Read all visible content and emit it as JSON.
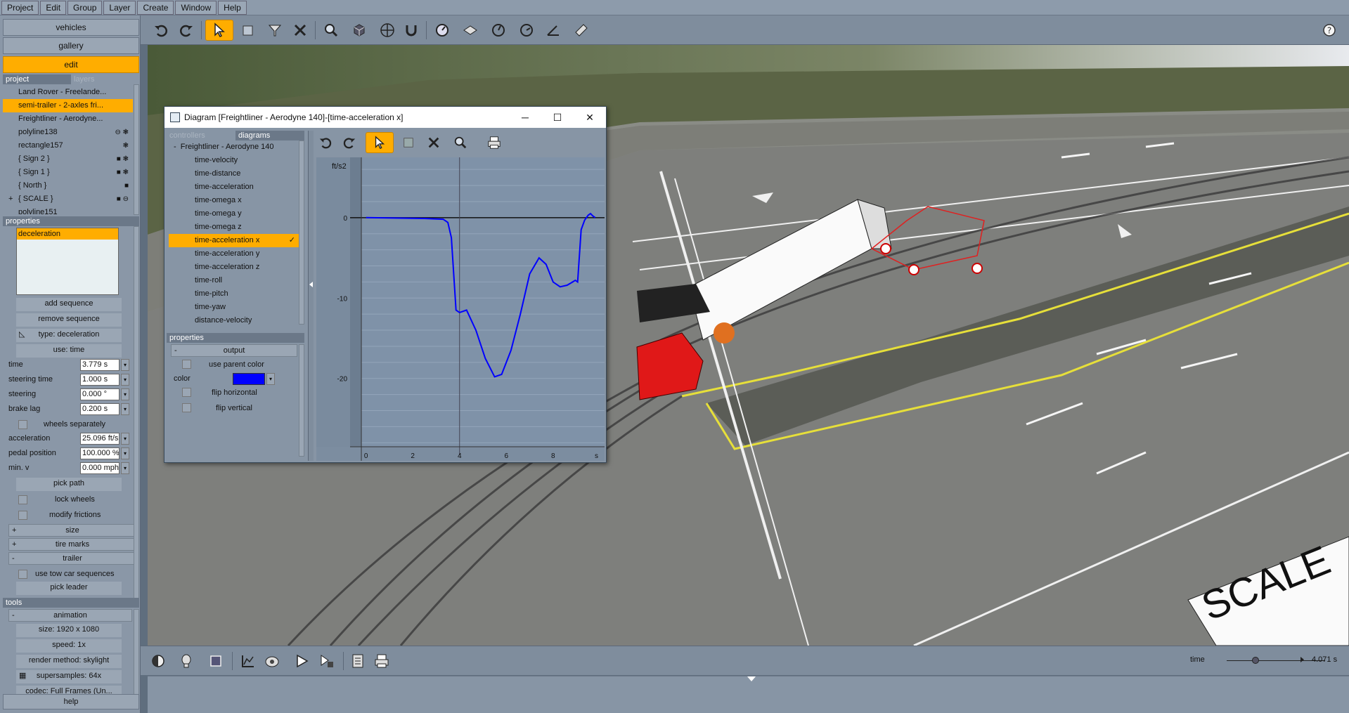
{
  "menu": [
    "Project",
    "Edit",
    "Group",
    "Layer",
    "Create",
    "Window",
    "Help"
  ],
  "left": {
    "top_buttons": [
      "vehicles",
      "gallery",
      "edit"
    ],
    "active_button": "edit",
    "tabs": [
      "project",
      "layers"
    ],
    "tree": [
      {
        "label": "Land Rover - Freelande...",
        "selected": false,
        "prefix": ""
      },
      {
        "label": "semi-trailer - 2-axles fri...",
        "selected": true,
        "prefix": ""
      },
      {
        "label": "Freightliner - Aerodyne...",
        "selected": false,
        "prefix": ""
      },
      {
        "label": "polyline138",
        "selected": false,
        "prefix": ""
      },
      {
        "label": "rectangle157",
        "selected": false,
        "prefix": ""
      },
      {
        "label": "{ Sign 2 }",
        "selected": false,
        "prefix": ""
      },
      {
        "label": "{ Sign 1 }",
        "selected": false,
        "prefix": ""
      },
      {
        "label": "{ North }",
        "selected": false,
        "prefix": ""
      },
      {
        "label": "{ SCALE }",
        "selected": false,
        "prefix": "+"
      },
      {
        "label": "polyline151",
        "selected": false,
        "prefix": ""
      }
    ],
    "properties_header": "properties",
    "sequence_selected": "deceleration",
    "add_sequence": "add sequence",
    "remove_sequence": "remove sequence",
    "type_label": "type: deceleration",
    "use_label": "use: time",
    "fields": [
      {
        "label": "time",
        "value": "3.779 s"
      },
      {
        "label": "steering time",
        "value": "1.000 s"
      },
      {
        "label": "steering",
        "value": "0.000 °"
      },
      {
        "label": "brake lag",
        "value": "0.200 s"
      }
    ],
    "wheels_separately": "wheels separately",
    "fields2": [
      {
        "label": "acceleration",
        "value": "25.096 ft/s"
      },
      {
        "label": "pedal position",
        "value": "100.000 %"
      },
      {
        "label": "min. v",
        "value": "0.000 mph"
      }
    ],
    "pick_path": "pick path",
    "lock_wheels": "lock wheels",
    "modify_frictions": "modify frictions",
    "sections": [
      {
        "sign": "+",
        "label": "size"
      },
      {
        "sign": "+",
        "label": "tire marks"
      },
      {
        "sign": "-",
        "label": "trailer"
      }
    ],
    "use_tow": "use tow car sequences",
    "pick_leader": "pick leader",
    "tools_header": "tools",
    "animation": "animation",
    "tools": [
      "size: 1920 x 1080",
      "speed: 1x",
      "render method: skylight",
      "supersamples: 64x",
      "codec: Full Frames (Un..."
    ],
    "help": "help"
  },
  "diagram": {
    "title": "Diagram [Freightliner - Aerodyne 140]-[time-acceleration x]",
    "tabs": [
      "controllers",
      "diagrams"
    ],
    "root": "Freightliner - Aerodyne 140",
    "items": [
      "time-velocity",
      "time-distance",
      "time-acceleration",
      "time-omega x",
      "time-omega y",
      "time-omega z",
      "time-acceleration x",
      "time-acceleration y",
      "time-acceleration z",
      "time-roll",
      "time-pitch",
      "time-yaw",
      "distance-velocity"
    ],
    "selected_item": "time-acceleration x",
    "properties_header": "properties",
    "output_label": "output",
    "use_parent_color": "use parent color",
    "color_label": "color",
    "line_color": "#0000ff",
    "flip_horizontal": "flip horizontal",
    "flip_vertical": "flip vertical"
  },
  "chart_data": {
    "type": "line",
    "ylabel": "ft/s2",
    "xlabel": "s",
    "xlim": [
      -0.2,
      10.2
    ],
    "ylim": [
      -28.5,
      7.5
    ],
    "xticks": [
      0,
      2,
      4,
      6,
      8
    ],
    "yticks": [
      0,
      -10,
      -20
    ],
    "cursor_x": 4.0,
    "series": [
      {
        "color": "#0000ff",
        "x": [
          0,
          2.5,
          3.3,
          3.5,
          3.65,
          3.75,
          3.85,
          4.0,
          4.3,
          4.7,
          5.1,
          5.5,
          5.8,
          6.2,
          6.6,
          7.0,
          7.4,
          7.7,
          8.0,
          8.3,
          8.6,
          8.95,
          9.05,
          9.2,
          9.35,
          9.5,
          9.6,
          9.7,
          9.8
        ],
        "y": [
          0,
          -0.1,
          -0.2,
          -0.6,
          -2.5,
          -7,
          -11.5,
          -11.8,
          -11.5,
          -14,
          -17.5,
          -19.8,
          -19.5,
          -16.5,
          -12,
          -7,
          -5,
          -5.8,
          -8,
          -8.6,
          -8.4,
          -7.8,
          -8.0,
          -1.5,
          -0.3,
          0.3,
          0.5,
          0.2,
          0.0
        ]
      }
    ]
  },
  "bottom": {
    "time_label": "time",
    "time_value": "4.071 s"
  },
  "scene_sign": "SCALE"
}
